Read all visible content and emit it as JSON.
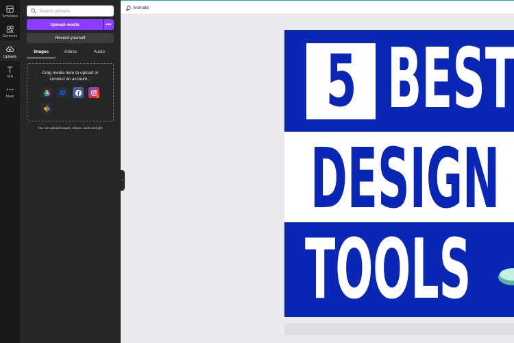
{
  "rail": {
    "items": [
      {
        "label": "Templates",
        "icon": "templates-icon"
      },
      {
        "label": "Elements",
        "icon": "elements-icon"
      },
      {
        "label": "Uploads",
        "icon": "uploads-icon",
        "active": true
      },
      {
        "label": "Text",
        "icon": "text-icon"
      },
      {
        "label": "More",
        "icon": "more-icon"
      }
    ]
  },
  "panel": {
    "search_placeholder": "Search uploads",
    "upload_label": "Upload media",
    "more_label": "•••",
    "record_label": "Record yourself",
    "tabs": [
      {
        "label": "Images",
        "active": true
      },
      {
        "label": "Videos"
      },
      {
        "label": "Audio"
      }
    ],
    "dropzone_text_1": "Drag media here to upload or",
    "dropzone_text_2": "connect an account...",
    "sources": [
      "google-drive-icon",
      "dropbox-icon",
      "facebook-icon",
      "instagram-icon",
      "google-photos-icon"
    ],
    "hint": "You can upload images, videos, audio and gifs"
  },
  "toolbar": {
    "animate_label": "Animate"
  },
  "design": {
    "number": "5",
    "line1": "BEST",
    "line2": "DESIGN",
    "line3": "TOOLS",
    "colors": {
      "blue": "#0a26b5",
      "white": "#ffffff"
    }
  },
  "colors": {
    "accent": "#8b3dff",
    "rail_bg": "#18191b",
    "panel_bg": "#252627",
    "canvas_bg": "#e8eaed"
  }
}
